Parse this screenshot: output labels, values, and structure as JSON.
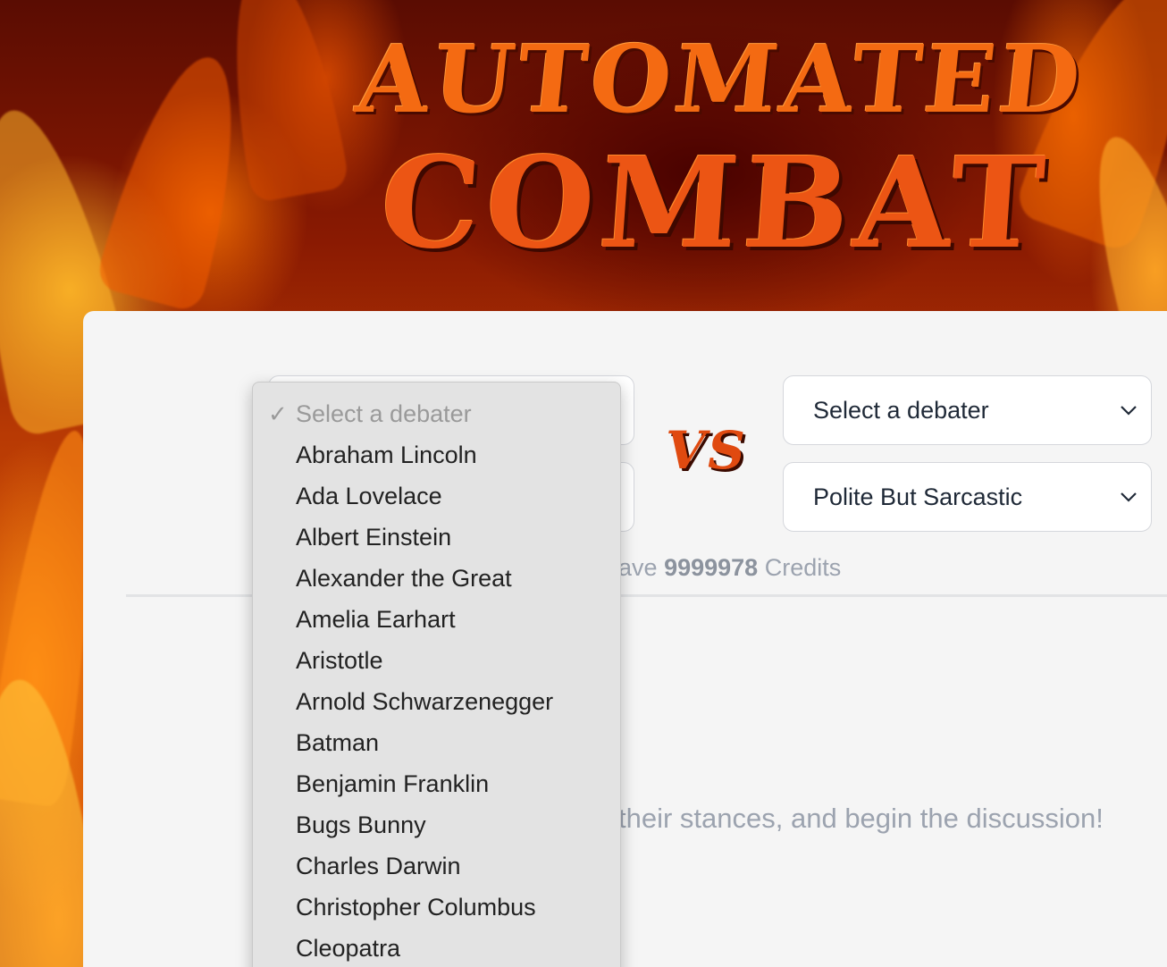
{
  "header": {
    "title_line1": "AUTOMATED",
    "title_line2": "COMBAT"
  },
  "debate_setup": {
    "vs_label": "VS",
    "right_debater_select": {
      "value": "Select a debater"
    },
    "right_style_select": {
      "value": "Polite But Sarcastic"
    },
    "credits": {
      "prefix": "ave",
      "amount": "9999978",
      "suffix": "Credits"
    },
    "prompt_text": "their stances, and begin the discussion!"
  },
  "dropdown": {
    "check_glyph": "✓",
    "placeholder": "Select a debater",
    "options": [
      "Abraham Lincoln",
      "Ada Lovelace",
      "Albert Einstein",
      "Alexander the Great",
      "Amelia Earhart",
      "Aristotle",
      "Arnold Schwarzenegger",
      "Batman",
      "Benjamin Franklin",
      "Bugs Bunny",
      "Charles Darwin",
      "Christopher Columbus",
      "Cleopatra"
    ]
  },
  "colors": {
    "title": "#f46a12",
    "panel_bg": "#f5f5f5",
    "muted_text": "#9ca3af"
  }
}
